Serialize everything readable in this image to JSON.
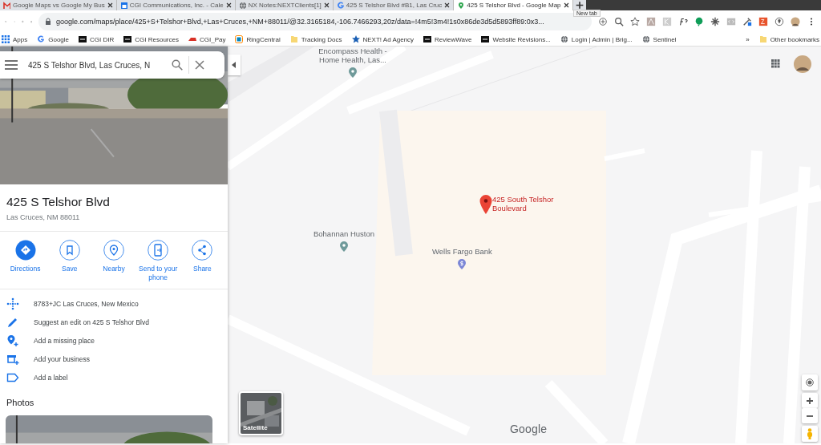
{
  "browser": {
    "tabs": [
      {
        "title": "Google Maps vs Google My Bus",
        "selected": false
      },
      {
        "title": "CGI Communications, Inc. - Cale",
        "selected": false
      },
      {
        "title": "NX Notes:NEXTClients[1]",
        "selected": false
      },
      {
        "title": "425 S Telshor Blvd #B1, Las Cruc",
        "selected": false
      },
      {
        "title": "425 S Telshor Blvd - Google Map",
        "selected": true
      }
    ],
    "new_tab_tooltip": "New tab",
    "url": "google.com/maps/place/425+S+Telshor+Blvd,+Las+Cruces,+NM+88011/@32.3165184,-106.7466293,20z/data=!4m5!3m4!1s0x86de3d5d5893ff89:0x3...",
    "bookmarks": [
      "Apps",
      "Google",
      "CGI DIR",
      "CGI Resources",
      "CGI_Pay",
      "RingCentral",
      "Tracking Docs",
      "NEXT! Ad Agency",
      "ReviewWave",
      "Website Revisions...",
      "Login | Admin | Brig...",
      "Sentinel"
    ],
    "more_bookmarks": "»",
    "other_bookmarks": "Other bookmarks"
  },
  "sidebar": {
    "search_value": "425 S Telshor Blvd, Las Cruces, N",
    "title": "425 S Telshor Blvd",
    "address": "Las Cruces, NM 88011",
    "actions": [
      "Directions",
      "Save",
      "Nearby",
      "Send to your phone",
      "Share"
    ],
    "info": [
      "8783+JC Las Cruces, New Mexico",
      "Suggest an edit on 425 S Telshor Blvd",
      "Add a missing place",
      "Add your business",
      "Add a label"
    ],
    "photos_heading": "Photos"
  },
  "map": {
    "labels": [
      {
        "kind": "poi",
        "text": "Encompass Health - Home Health, Las..."
      },
      {
        "kind": "pin",
        "text": "425 South Telshor Boulevard"
      },
      {
        "kind": "poi",
        "text": "Bohannan Huston"
      },
      {
        "kind": "bank",
        "text": "Wells Fargo Bank"
      }
    ],
    "satellite_label": "Satellite",
    "logo": "Google"
  }
}
